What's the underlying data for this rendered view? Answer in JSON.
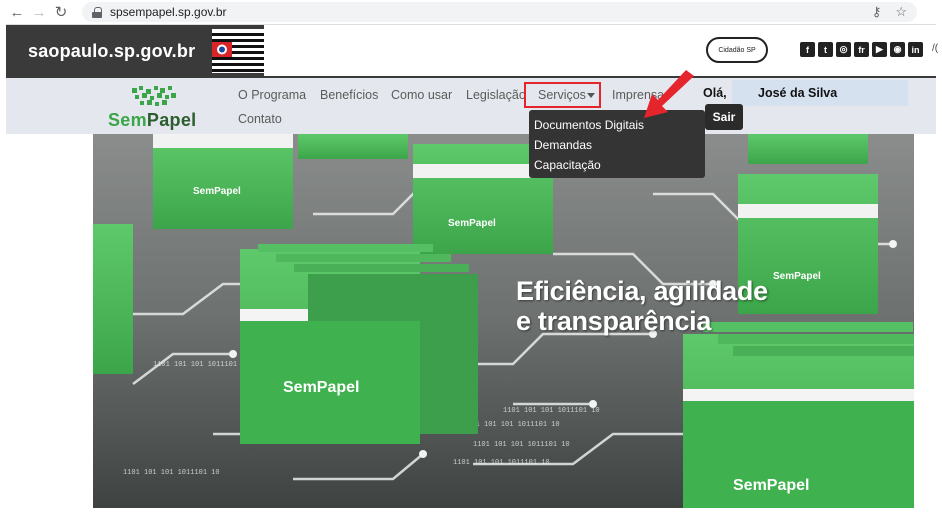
{
  "browser": {
    "url": "spsempapel.sp.gov.br",
    "icons": [
      "back-icon",
      "forward-icon",
      "reload-icon",
      "lock-icon",
      "key-icon",
      "star-icon"
    ]
  },
  "gov_header": {
    "site_name": "saopaulo.sp.gov.br",
    "cidadao_label": "Cidadão SP",
    "social": [
      "f",
      "t",
      "◎",
      "fr",
      "▶",
      "◉",
      "in"
    ],
    "trailing_text": "/("
  },
  "site": {
    "logo_sem": "Sem",
    "logo_papel": "Papel",
    "menu": {
      "programa": "O Programa",
      "beneficios": "Benefícios",
      "como_usar": "Como usar",
      "legislacao": "Legislação",
      "servicos": "Serviços",
      "imprensa": "Imprensa",
      "contato": "Contato"
    },
    "greeting": "Olá,",
    "user_name": "José da Silva",
    "logout": "Sair"
  },
  "dropdown": {
    "items": [
      "Documentos Digitais",
      "Demandas",
      "Capacitação"
    ]
  },
  "hero": {
    "line1": "Eficiência, agilidade",
    "line2": "e transparência",
    "folder_label": "SemPapel",
    "binary_text": "1101 101 101 1011101 10"
  },
  "colors": {
    "brand_green": "#3aa647",
    "dark_green": "#2d5d2e",
    "header_dark": "#3a3a3a",
    "highlight_red": "#e4252c"
  }
}
